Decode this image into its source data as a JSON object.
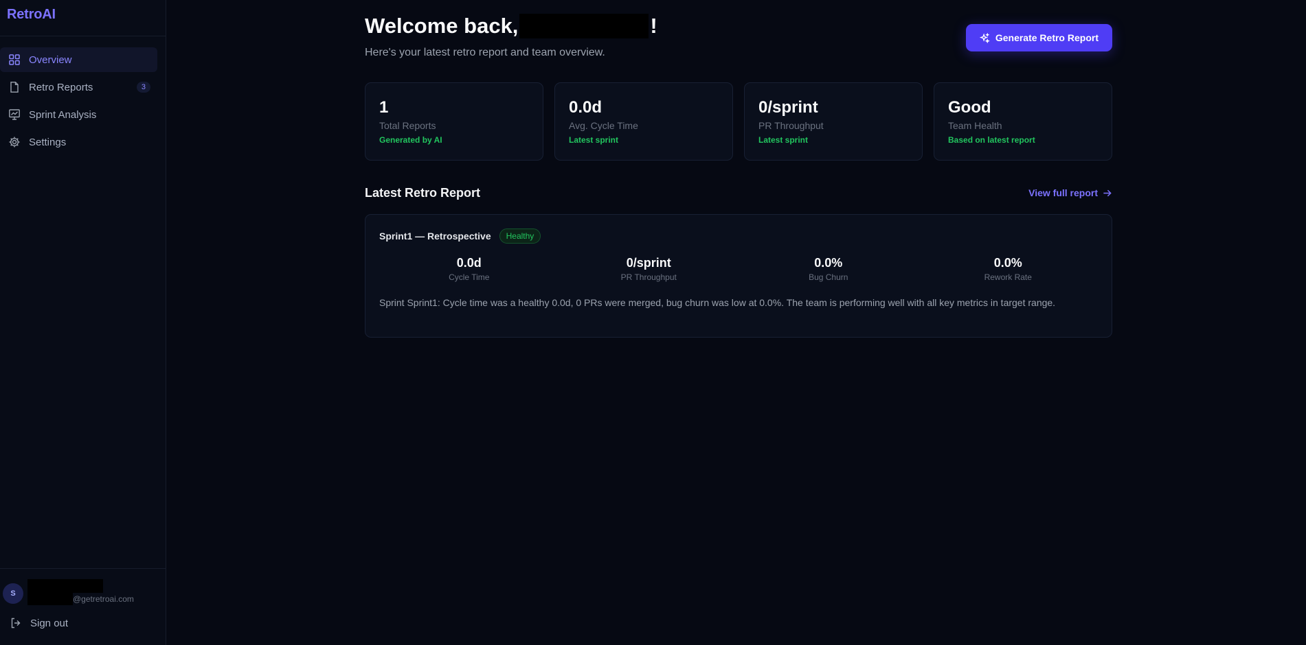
{
  "app": {
    "brand": "RetroAI"
  },
  "sidebar": {
    "items": [
      {
        "label": "Overview",
        "icon": "grid-icon",
        "active": true
      },
      {
        "label": "Retro Reports",
        "icon": "file-icon",
        "badge": "3"
      },
      {
        "label": "Sprint Analysis",
        "icon": "chart-icon"
      },
      {
        "label": "Settings",
        "icon": "gear-icon"
      }
    ],
    "user": {
      "avatar_initial": "S",
      "email": "@getretroai.com"
    },
    "signout_label": "Sign out"
  },
  "header": {
    "welcome_prefix": "Welcome back,",
    "welcome_suffix": "!",
    "subtitle": "Here's your latest retro report and team overview.",
    "generate_button": "Generate Retro Report"
  },
  "stats": [
    {
      "value": "1",
      "label": "Total Reports",
      "note": "Generated by AI"
    },
    {
      "value": "0.0d",
      "label": "Avg. Cycle Time",
      "note": "Latest sprint"
    },
    {
      "value": "0/sprint",
      "label": "PR Throughput",
      "note": "Latest sprint"
    },
    {
      "value": "Good",
      "label": "Team Health",
      "note": "Based on latest report"
    }
  ],
  "latest": {
    "section_title": "Latest Retro Report",
    "view_link": "View full report",
    "report_title": "Sprint1 — Retrospective",
    "status_badge": "Healthy",
    "metrics": [
      {
        "value": "0.0d",
        "label": "Cycle Time"
      },
      {
        "value": "0/sprint",
        "label": "PR Throughput"
      },
      {
        "value": "0.0%",
        "label": "Bug Churn"
      },
      {
        "value": "0.0%",
        "label": "Rework Rate"
      }
    ],
    "summary": "Sprint Sprint1: Cycle time was a healthy 0.0d, 0 PRs were merged, bug churn was low at 0.0%. The team is performing well with all key metrics in target range."
  },
  "colors": {
    "accent": "#4f3df5",
    "brand": "#7c72ff",
    "success": "#22c55e",
    "background": "#060913"
  }
}
